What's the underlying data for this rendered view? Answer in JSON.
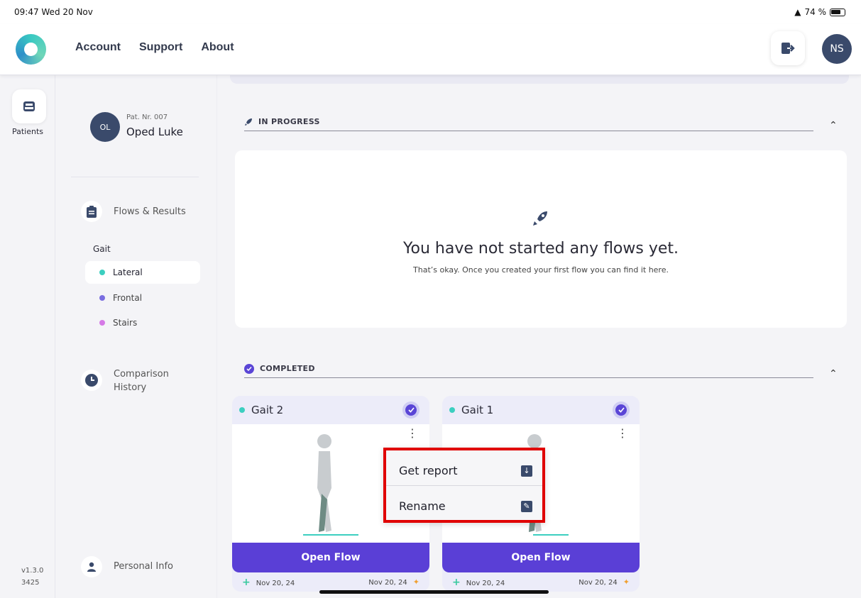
{
  "status_bar": {
    "time_date": "09:47  Wed 20 Nov",
    "battery": "74 %"
  },
  "header": {
    "nav": [
      "Account",
      "Support",
      "About"
    ],
    "user_initials": "NS"
  },
  "rail": {
    "patients_label": "Patients",
    "version": "v1.3.0",
    "build": "3425"
  },
  "patient": {
    "initials": "OL",
    "number": "Pat. Nr. 007",
    "name": "Oped Luke"
  },
  "sidebar": {
    "flows_label": "Flows & Results",
    "group_label": "Gait",
    "items": [
      {
        "label": "Lateral",
        "color": "#3ccfc0"
      },
      {
        "label": "Frontal",
        "color": "#7a6ee0"
      },
      {
        "label": "Stairs",
        "color": "#d57ae6"
      }
    ],
    "comparison_label_1": "Comparison",
    "comparison_label_2": "History",
    "personal_info_label": "Personal Info"
  },
  "in_progress": {
    "heading": "IN PROGRESS",
    "empty_title": "You have not started any flows yet.",
    "empty_subtitle": "That’s okay. Once you created your first flow you can find it here."
  },
  "completed": {
    "heading": "COMPLETED",
    "cards": [
      {
        "title": "Gait 2",
        "open_label": "Open Flow",
        "created": "Nov 20, 24",
        "updated": "Nov 20, 24"
      },
      {
        "title": "Gait 1",
        "open_label": "Open Flow",
        "created": "Nov 20, 24",
        "updated": "Nov 20, 24"
      }
    ]
  },
  "context_menu": {
    "get_report": "Get report",
    "rename": "Rename"
  },
  "colors": {
    "accent": "#5a3fd6",
    "highlight": "#e00000",
    "teal": "#3ccfc0"
  }
}
